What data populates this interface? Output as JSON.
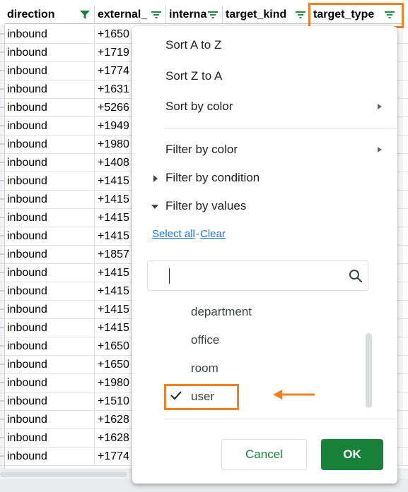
{
  "columns": [
    "direction",
    "external_",
    "interna",
    "target_kind",
    "target_type"
  ],
  "rows": [
    [
      "inbound",
      "+1650"
    ],
    [
      "inbound",
      "+1719"
    ],
    [
      "inbound",
      "+1774"
    ],
    [
      "inbound",
      "+1631"
    ],
    [
      "inbound",
      "+5266"
    ],
    [
      "inbound",
      "+1949"
    ],
    [
      "inbound",
      "+1980"
    ],
    [
      "inbound",
      "+1408"
    ],
    [
      "inbound",
      "+1415"
    ],
    [
      "inbound",
      "+1415"
    ],
    [
      "inbound",
      "+1415"
    ],
    [
      "inbound",
      "+1415"
    ],
    [
      "inbound",
      "+1857"
    ],
    [
      "inbound",
      "+1415"
    ],
    [
      "inbound",
      "+1415"
    ],
    [
      "inbound",
      "+1415"
    ],
    [
      "inbound",
      "+1415"
    ],
    [
      "inbound",
      "+1650"
    ],
    [
      "inbound",
      "+1650"
    ],
    [
      "inbound",
      "+1980"
    ],
    [
      "inbound",
      "+1510"
    ],
    [
      "inbound",
      "+1628"
    ],
    [
      "inbound",
      "+1628"
    ],
    [
      "inbound",
      "+1774"
    ]
  ],
  "menu": {
    "sort_az": "Sort A to Z",
    "sort_za": "Sort Z to A",
    "sort_color": "Sort by color",
    "filter_color": "Filter by color",
    "filter_condition": "Filter by condition",
    "filter_values": "Filter by values",
    "select_all": "Select all",
    "dash": "-",
    "clear": "Clear",
    "search_value": "",
    "values": [
      {
        "label": "department",
        "checked": false
      },
      {
        "label": "office",
        "checked": false
      },
      {
        "label": "room",
        "checked": false
      },
      {
        "label": "user",
        "checked": true
      }
    ],
    "cancel": "Cancel",
    "ok": "OK"
  },
  "colors": {
    "accent_green": "#188038",
    "link_blue": "#1a73e8",
    "highlight_orange": "#f08020",
    "filter_active_green": "#188038",
    "filter_icon_green": "#1e8e3e"
  },
  "icons": [
    "filter-icon",
    "search-icon",
    "check-icon",
    "chevron-right-icon",
    "triangle-right-icon",
    "triangle-down-icon",
    "arrow-left-icon"
  ]
}
